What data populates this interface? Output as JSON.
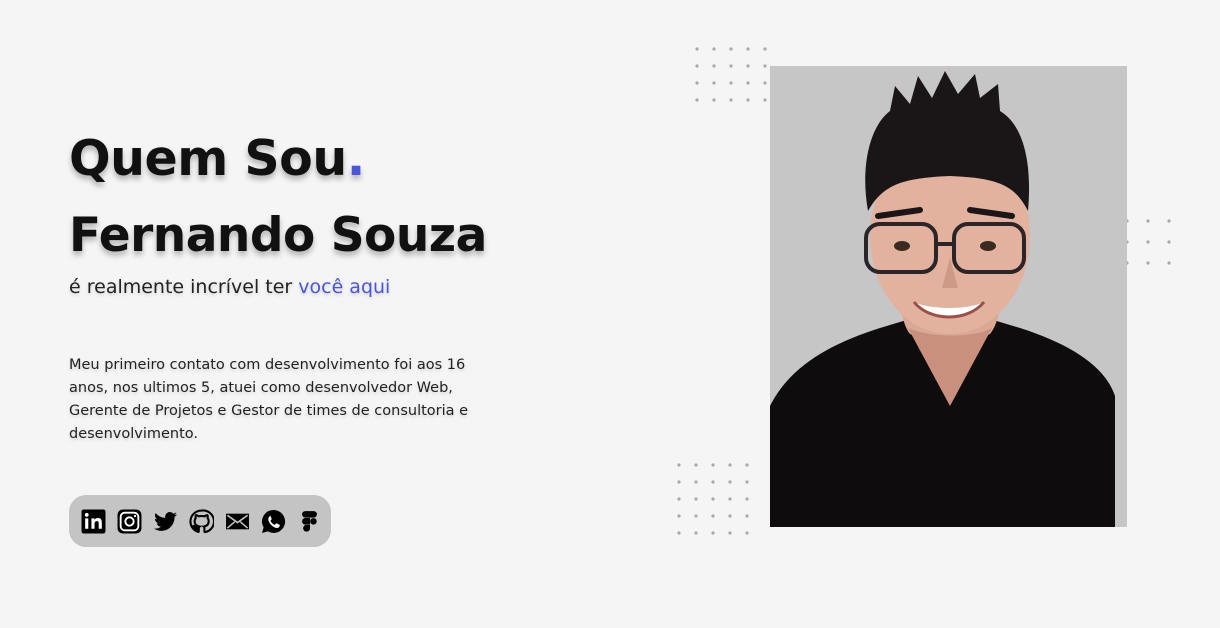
{
  "hero": {
    "title": "Quem Sou",
    "title_dot": ".",
    "name": "Fernando Souza",
    "subtitle_prefix": "é realmente incrível ter ",
    "subtitle_accent": "você aqui"
  },
  "bio": "Meu primeiro contato com desenvolvimento foi aos 16 anos, nos ultimos 5, atuei como desenvolvedor Web, Gerente de Projetos e Gestor de times de consultoria e desenvolvimento.",
  "social": [
    {
      "icon": "linkedin-icon"
    },
    {
      "icon": "instagram-icon"
    },
    {
      "icon": "twitter-icon"
    },
    {
      "icon": "github-icon"
    },
    {
      "icon": "email-icon"
    },
    {
      "icon": "whatsapp-icon"
    },
    {
      "icon": "figma-icon"
    }
  ],
  "colors": {
    "accent": "#4a56d6",
    "background": "#f5f5f5",
    "social_bar": "#c4c4c4"
  }
}
